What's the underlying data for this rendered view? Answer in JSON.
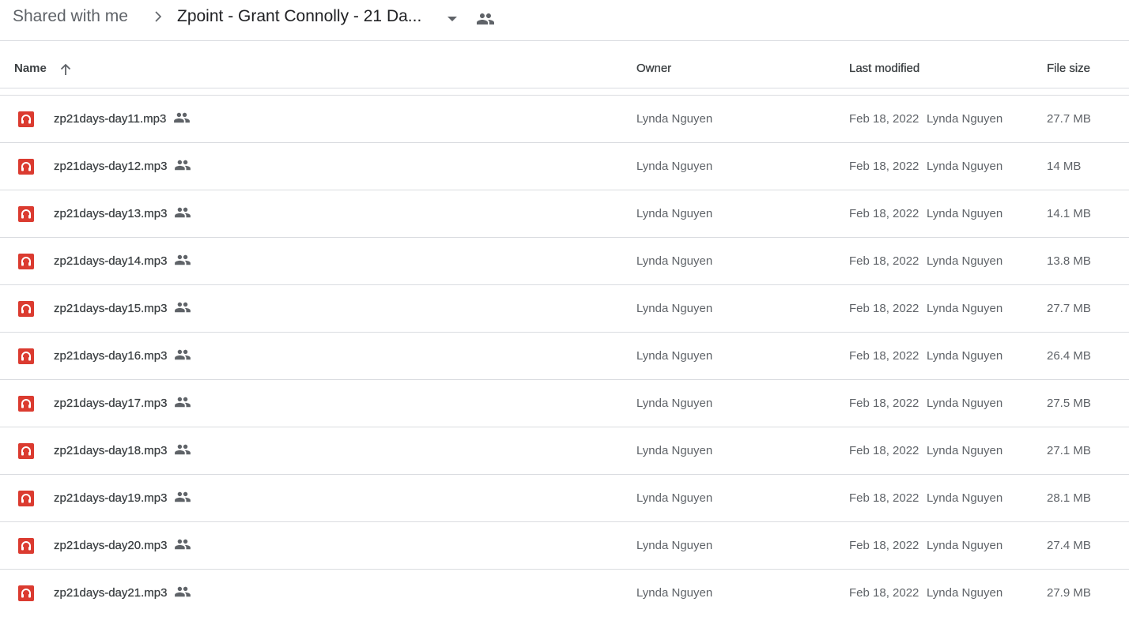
{
  "breadcrumb": {
    "root": "Shared with me",
    "current": "Zpoint - Grant Connolly - 21 Da...",
    "separator_icon": "chevron-right-icon",
    "dropdown_icon": "arrow-drop-down-icon",
    "shared_icon": "people-icon"
  },
  "columns": {
    "name": "Name",
    "owner": "Owner",
    "last_modified": "Last modified",
    "file_size": "File size",
    "sort_icon": "arrow-upward-icon"
  },
  "colors": {
    "audio_icon": "#db3b30",
    "divider": "#dadce0",
    "text_primary": "#3c4043",
    "text_secondary": "#5f6368"
  },
  "files": [
    {
      "name": "zp21days-day11.mp3",
      "owner": "Lynda Nguyen",
      "modified_date": "Feb 18, 2022",
      "modified_by": "Lynda Nguyen",
      "size": "27.7 MB",
      "icon": "audio-file-icon",
      "shared": true
    },
    {
      "name": "zp21days-day12.mp3",
      "owner": "Lynda Nguyen",
      "modified_date": "Feb 18, 2022",
      "modified_by": "Lynda Nguyen",
      "size": "14 MB",
      "icon": "audio-file-icon",
      "shared": true
    },
    {
      "name": "zp21days-day13.mp3",
      "owner": "Lynda Nguyen",
      "modified_date": "Feb 18, 2022",
      "modified_by": "Lynda Nguyen",
      "size": "14.1 MB",
      "icon": "audio-file-icon",
      "shared": true
    },
    {
      "name": "zp21days-day14.mp3",
      "owner": "Lynda Nguyen",
      "modified_date": "Feb 18, 2022",
      "modified_by": "Lynda Nguyen",
      "size": "13.8 MB",
      "icon": "audio-file-icon",
      "shared": true
    },
    {
      "name": "zp21days-day15.mp3",
      "owner": "Lynda Nguyen",
      "modified_date": "Feb 18, 2022",
      "modified_by": "Lynda Nguyen",
      "size": "27.7 MB",
      "icon": "audio-file-icon",
      "shared": true
    },
    {
      "name": "zp21days-day16.mp3",
      "owner": "Lynda Nguyen",
      "modified_date": "Feb 18, 2022",
      "modified_by": "Lynda Nguyen",
      "size": "26.4 MB",
      "icon": "audio-file-icon",
      "shared": true
    },
    {
      "name": "zp21days-day17.mp3",
      "owner": "Lynda Nguyen",
      "modified_date": "Feb 18, 2022",
      "modified_by": "Lynda Nguyen",
      "size": "27.5 MB",
      "icon": "audio-file-icon",
      "shared": true
    },
    {
      "name": "zp21days-day18.mp3",
      "owner": "Lynda Nguyen",
      "modified_date": "Feb 18, 2022",
      "modified_by": "Lynda Nguyen",
      "size": "27.1 MB",
      "icon": "audio-file-icon",
      "shared": true
    },
    {
      "name": "zp21days-day19.mp3",
      "owner": "Lynda Nguyen",
      "modified_date": "Feb 18, 2022",
      "modified_by": "Lynda Nguyen",
      "size": "28.1 MB",
      "icon": "audio-file-icon",
      "shared": true
    },
    {
      "name": "zp21days-day20.mp3",
      "owner": "Lynda Nguyen",
      "modified_date": "Feb 18, 2022",
      "modified_by": "Lynda Nguyen",
      "size": "27.4 MB",
      "icon": "audio-file-icon",
      "shared": true
    },
    {
      "name": "zp21days-day21.mp3",
      "owner": "Lynda Nguyen",
      "modified_date": "Feb 18, 2022",
      "modified_by": "Lynda Nguyen",
      "size": "27.9 MB",
      "icon": "audio-file-icon",
      "shared": true
    }
  ]
}
